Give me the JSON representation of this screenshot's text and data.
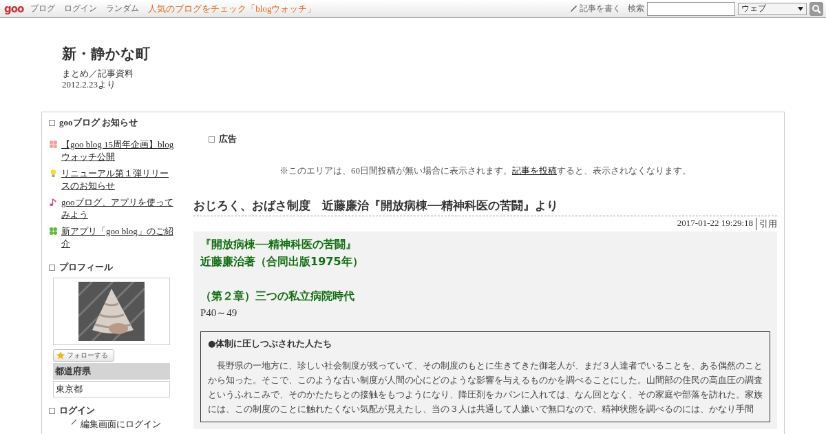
{
  "topbar": {
    "logo": "goo",
    "links": [
      {
        "label": "ブログ",
        "kind": "plain"
      },
      {
        "label": "ログイン",
        "kind": "plain"
      },
      {
        "label": "ランダム",
        "kind": "plain"
      },
      {
        "label": "人気のブログをチェック「blogウォッチ」",
        "kind": "promo"
      }
    ],
    "write_link": "記事を書く",
    "search_label": "検索",
    "search_scope": "ウェブ"
  },
  "blog": {
    "title": "新・静かな町",
    "subtitle": "まとめ／記事資料",
    "since": "2012.2.23より"
  },
  "sidebar": {
    "notice_heading": "gooブログ お知らせ",
    "notices": [
      {
        "label": "【goo blog 15周年企画】blogウォッチ公開"
      },
      {
        "label": "リニューアル第１弾リリースのお知らせ"
      },
      {
        "label": "gooブログ、アプリを使ってみよう"
      },
      {
        "label": "新アプリ「goo blog」のご紹介"
      }
    ],
    "profile_heading": "プロフィール",
    "follow_button": "フォローする",
    "pref_label": "都道府県",
    "pref_value": "東京都",
    "login_heading": "ログイン",
    "login_link": "編集画面にログイン"
  },
  "ad": {
    "heading": "広告",
    "notice_before": "※このエリアは、60日間投稿が無い場合に表示されます。",
    "notice_link": "記事を投稿",
    "notice_after": "すると、表示されなくなります。"
  },
  "post": {
    "title": "おじろく、おばさ制度　近藤廉治『開放病棟──精神科医の苦闘』より",
    "date": "2017-01-22 19:29:18",
    "trackback": "引用",
    "lines": [
      {
        "kind": "green",
        "text": "『開放病棟──精神科医の苦闘』"
      },
      {
        "kind": "green",
        "text": "近藤廉治著（合同出版1975年）"
      },
      {
        "kind": "gap"
      },
      {
        "kind": "green",
        "text": "（第２章）三つの私立病院時代"
      },
      {
        "kind": "plain",
        "text": "P40～49"
      }
    ],
    "quote_heading": "●体制に圧しつぶされた人たち",
    "quote_text": "　長野県の一地方に、珍しい社会制度が残っていて、その制度のもとに生きてきた御老人が、まだ３人達者でいることを、ある偶然のことから知った。そこで、このような古い制度が人間の心にどのような影響を与えるものかを調べることにした。山間部の住民の高血圧の調査というふれこみで、そのかたたちとの接触をもつようになり、降圧剤をカバンに入れては、なん回となく、その家庭や部落を訪れた。家族には、この制度のことに触れたくない気配が見えたし、当の３人は共通して人嫌いで無口なので、精神状態を調べるのには、かなり手間"
  }
}
